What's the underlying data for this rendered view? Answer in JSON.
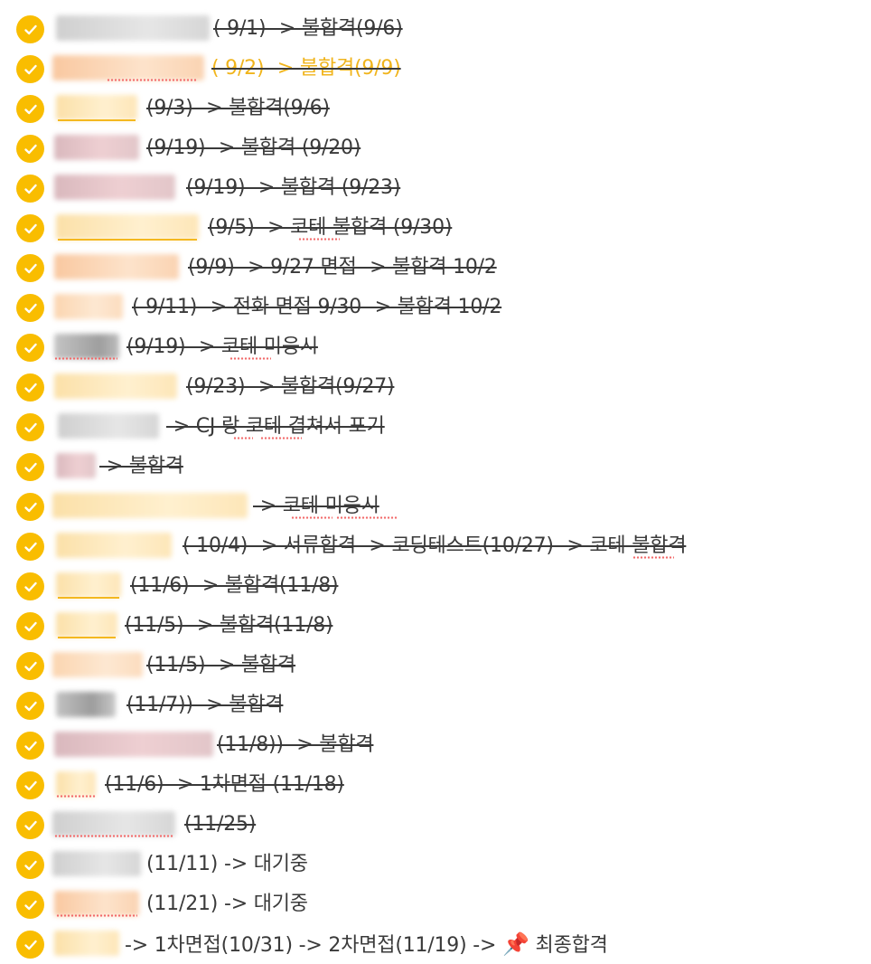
{
  "items": [
    {
      "text": "(  9/1) -> 불합격(9/6)",
      "done": true
    },
    {
      "text": "(  9/2) -> 불합격(9/9)",
      "done": true
    },
    {
      "text": "(9/3) -> 불합격(9/6)",
      "done": true
    },
    {
      "text": "(9/19) -> 불합격 (9/20)",
      "done": true
    },
    {
      "text": "(9/19) -> 불합격 (9/23)",
      "done": true
    },
    {
      "text": "(9/5) -> 코테 불합격 (9/30)",
      "done": true
    },
    {
      "text": "(9/9) -> 9/27 면접 -> 불합격 10/2",
      "done": true
    },
    {
      "text": "(  9/11) -> 전화 면접 9/30 -> 불합격 10/2",
      "done": true
    },
    {
      "text": "(9/19) -> 코테 미응시",
      "done": true
    },
    {
      "text": "(9/23) -> 불합격(9/27)",
      "done": true
    },
    {
      "text": "-> CJ 랑 코테 겹쳐서 포기",
      "done": true
    },
    {
      "text": "-> 불합격",
      "done": true
    },
    {
      "text": "-> 코테 미응시",
      "done": true
    },
    {
      "text": "(  10/4) -> 서류합격 -> 코딩테스트(10/27) -> 코테 불합격",
      "done": true
    },
    {
      "text": "(11/6) -> 불합격(11/8)",
      "done": true
    },
    {
      "text": "(11/5) -> 불합격(11/8)",
      "done": true
    },
    {
      "text": "(11/5) -> 불합격",
      "done": true
    },
    {
      "text": "(11/7)) -> 불합격",
      "done": true
    },
    {
      "text": "(11/8)) -> 불합격",
      "done": true
    },
    {
      "text": "(11/6) -> 1차면접 (11/18)",
      "done": true
    },
    {
      "text": "(11/25)",
      "done": true
    },
    {
      "text": "(11/11) -> 대기중",
      "done": false
    },
    {
      "text": "(11/21) -> 대기중",
      "done": false
    },
    {
      "text": "-> 1차면접(10/31) -> 2차면접(11/19) ->",
      "done": false,
      "emoji": "📌",
      "tail": "최종합격"
    }
  ],
  "colors": {
    "check": "#f9bd00",
    "text": "#3a3a3a",
    "accent": "#f0b41c"
  },
  "icons": {
    "check": "check-circle-icon",
    "pin": "pushpin-icon"
  }
}
